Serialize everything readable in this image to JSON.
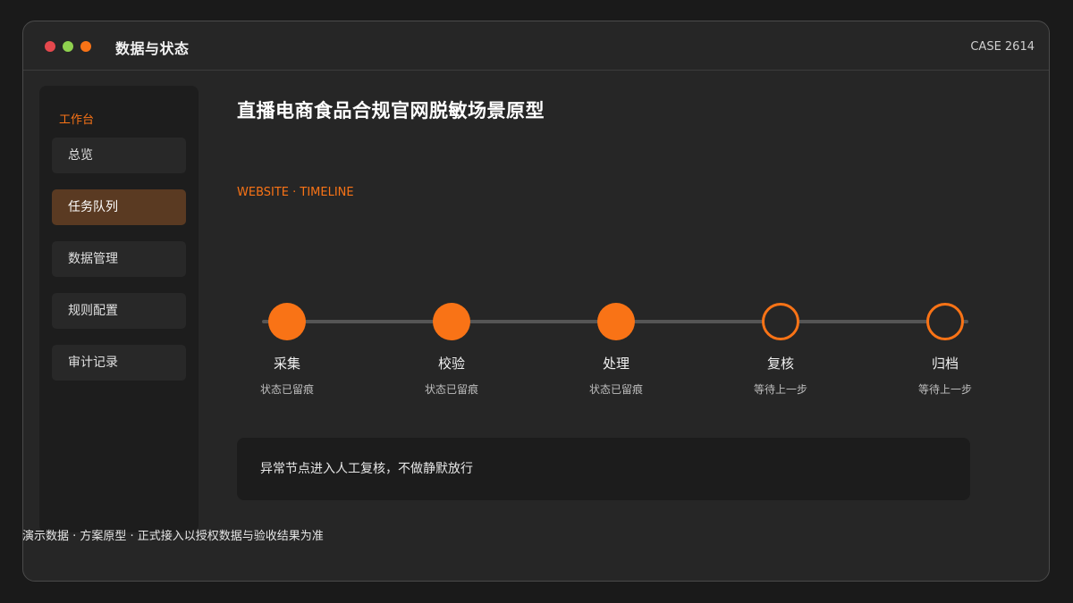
{
  "window": {
    "title": "数据与状态",
    "case_id": "CASE 2614",
    "colors": {
      "accent": "#f97316",
      "close": "#e5484d",
      "maximize": "#8fd14f",
      "minimize": "#f97316"
    }
  },
  "sidebar": {
    "heading": "工作台",
    "items": [
      {
        "label": "总览",
        "active": false
      },
      {
        "label": "任务队列",
        "active": true
      },
      {
        "label": "数据管理",
        "active": false
      },
      {
        "label": "规则配置",
        "active": false
      },
      {
        "label": "审计记录",
        "active": false
      }
    ]
  },
  "main": {
    "title": "直播电商食品合规官网脱敏场景原型",
    "subtitle": "WEBSITE · TIMELINE",
    "timeline": {
      "steps": [
        {
          "label": "采集",
          "status": "状态已留痕",
          "completed": true
        },
        {
          "label": "校验",
          "status": "状态已留痕",
          "completed": true
        },
        {
          "label": "处理",
          "status": "状态已留痕",
          "completed": true
        },
        {
          "label": "复核",
          "status": "等待上一步",
          "completed": false
        },
        {
          "label": "归档",
          "status": "等待上一步",
          "completed": false
        }
      ]
    },
    "notice": "异常节点进入人工复核，不做静默放行"
  },
  "footer": "演示数据 · 方案原型 · 正式接入以授权数据与验收结果为准"
}
